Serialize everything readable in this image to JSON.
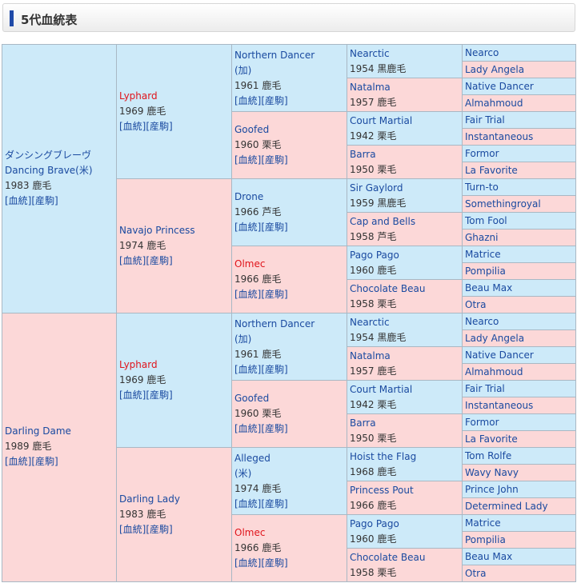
{
  "header": {
    "title": "5代血統表"
  },
  "g1": [
    {
      "name": "ダンシングブレーヴ",
      "sub": "Dancing Brave(米)",
      "info": "1983 鹿毛",
      "links": [
        "[血統]",
        "[産駒]"
      ]
    },
    {
      "name": "Darling Dame",
      "info": "1989 鹿毛",
      "links": [
        "[血統]",
        "[産駒]"
      ]
    }
  ],
  "g2": [
    {
      "name": "Lyphard",
      "info": "1969 鹿毛",
      "links": [
        "[血統]",
        "[産駒]"
      ]
    },
    {
      "name": "Navajo Princess",
      "info": "1974 鹿毛",
      "links": [
        "[血統]",
        "[産駒]"
      ]
    },
    {
      "name": "Lyphard",
      "info": "1969 鹿毛",
      "links": [
        "[血統]",
        "[産駒]"
      ]
    },
    {
      "name": "Darling Lady",
      "info": "1983 鹿毛",
      "links": [
        "[血統]",
        "[産駒]"
      ]
    }
  ],
  "g3": [
    {
      "name": "Northern Dancer",
      "sub": "(加)",
      "info": "1961 鹿毛",
      "links": [
        "[血統]",
        "[産駒]"
      ]
    },
    {
      "name": "Goofed",
      "info": "1960 栗毛",
      "links": [
        "[血統]",
        "[産駒]"
      ]
    },
    {
      "name": "Drone",
      "info": "1966 芦毛",
      "links": [
        "[血統]",
        "[産駒]"
      ]
    },
    {
      "name": "Olmec",
      "info": "1966 鹿毛",
      "links": [
        "[血統]",
        "[産駒]"
      ]
    },
    {
      "name": "Northern Dancer",
      "sub": "(加)",
      "info": "1961 鹿毛",
      "links": [
        "[血統]",
        "[産駒]"
      ]
    },
    {
      "name": "Goofed",
      "info": "1960 栗毛",
      "links": [
        "[血統]",
        "[産駒]"
      ]
    },
    {
      "name": "Alleged",
      "sub": "(米)",
      "info": "1974 鹿毛",
      "links": [
        "[血統]",
        "[産駒]"
      ]
    },
    {
      "name": "Olmec",
      "info": "1966 鹿毛",
      "links": [
        "[血統]",
        "[産駒]"
      ]
    }
  ],
  "g4": [
    {
      "name": "Nearctic",
      "info": "1954 黒鹿毛"
    },
    {
      "name": "Natalma",
      "info": "1957 鹿毛"
    },
    {
      "name": "Court Martial",
      "info": "1942 栗毛"
    },
    {
      "name": "Barra",
      "info": "1950 栗毛"
    },
    {
      "name": "Sir Gaylord",
      "info": "1959 黒鹿毛"
    },
    {
      "name": "Cap and Bells",
      "info": "1958 芦毛"
    },
    {
      "name": "Pago Pago",
      "info": "1960 鹿毛"
    },
    {
      "name": "Chocolate Beau",
      "info": "1958 栗毛"
    },
    {
      "name": "Nearctic",
      "info": "1954 黒鹿毛"
    },
    {
      "name": "Natalma",
      "info": "1957 鹿毛"
    },
    {
      "name": "Court Martial",
      "info": "1942 栗毛"
    },
    {
      "name": "Barra",
      "info": "1950 栗毛"
    },
    {
      "name": "Hoist the Flag",
      "info": "1968 鹿毛"
    },
    {
      "name": "Princess Pout",
      "info": "1966 鹿毛"
    },
    {
      "name": "Pago Pago",
      "info": "1960 鹿毛"
    },
    {
      "name": "Chocolate Beau",
      "info": "1958 栗毛"
    }
  ],
  "g5": [
    "Nearco",
    "Lady Angela",
    "Native Dancer",
    "Almahmoud",
    "Fair Trial",
    "Instantaneous",
    "Formor",
    "La Favorite",
    "Turn-to",
    "Somethingroyal",
    "Tom Fool",
    "Ghazni",
    "Matrice",
    "Pompilia",
    "Beau Max",
    "Otra",
    "Nearco",
    "Lady Angela",
    "Native Dancer",
    "Almahmoud",
    "Fair Trial",
    "Instantaneous",
    "Formor",
    "La Favorite",
    "Tom Rolfe",
    "Wavy Navy",
    "Prince John",
    "Determined Lady",
    "Matrice",
    "Pompilia",
    "Beau Max",
    "Otra"
  ],
  "red_names": [
    "Lyphard",
    "Olmec"
  ]
}
